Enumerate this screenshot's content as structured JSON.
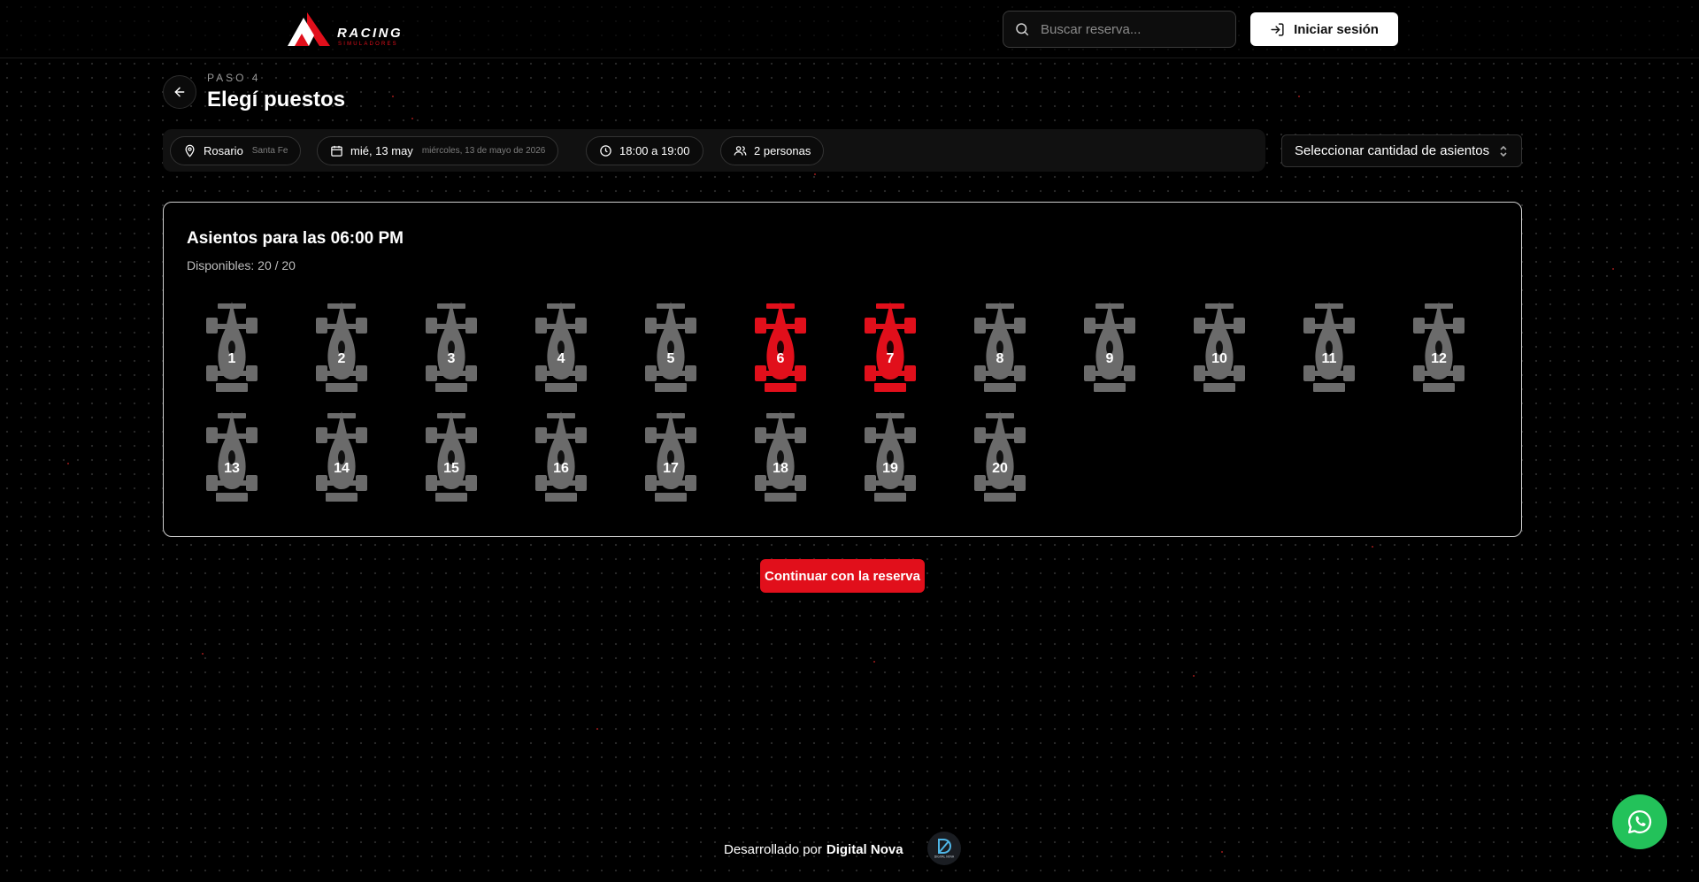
{
  "header": {
    "logo_word": "RACING",
    "logo_sub": "SIMULADORES",
    "search_placeholder": "Buscar reserva...",
    "login_label": "Iniciar sesión"
  },
  "page": {
    "step_label": "PASO 4",
    "title": "Elegí puestos"
  },
  "filters": {
    "location": {
      "label": "Rosario",
      "sub": "Santa Fe",
      "icon": "map-pin-icon"
    },
    "date": {
      "label": "mié, 13 may",
      "sub": "miércoles, 13 de mayo de 2026",
      "icon": "calendar-icon"
    },
    "time": {
      "label": "18:00 a 19:00",
      "icon": "clock-icon"
    },
    "people": {
      "label": "2 personas",
      "icon": "users-icon"
    },
    "seat_count_select": "Seleccionar cantidad de asientos"
  },
  "seats_panel": {
    "title": "Asientos para las 06:00 PM",
    "available": "Disponibles: 20 / 20",
    "seats": [
      {
        "number": "1",
        "selected": false
      },
      {
        "number": "2",
        "selected": false
      },
      {
        "number": "3",
        "selected": false
      },
      {
        "number": "4",
        "selected": false
      },
      {
        "number": "5",
        "selected": false
      },
      {
        "number": "6",
        "selected": true
      },
      {
        "number": "7",
        "selected": true
      },
      {
        "number": "8",
        "selected": false
      },
      {
        "number": "9",
        "selected": false
      },
      {
        "number": "10",
        "selected": false
      },
      {
        "number": "11",
        "selected": false
      },
      {
        "number": "12",
        "selected": false
      },
      {
        "number": "13",
        "selected": false
      },
      {
        "number": "14",
        "selected": false
      },
      {
        "number": "15",
        "selected": false
      },
      {
        "number": "16",
        "selected": false
      },
      {
        "number": "17",
        "selected": false
      },
      {
        "number": "18",
        "selected": false
      },
      {
        "number": "19",
        "selected": false
      },
      {
        "number": "20",
        "selected": false
      }
    ]
  },
  "continue_label": "Continuar con la reserva",
  "footer": {
    "prefix": "Desarrollado por",
    "brand": "Digital Nova",
    "logo_text": "DIGITAL NOVA"
  },
  "colors": {
    "accent": "#e10f1b",
    "seat_available": "#6b6b6b",
    "seat_selected": "#e10f1b",
    "whatsapp": "#23c25a"
  }
}
